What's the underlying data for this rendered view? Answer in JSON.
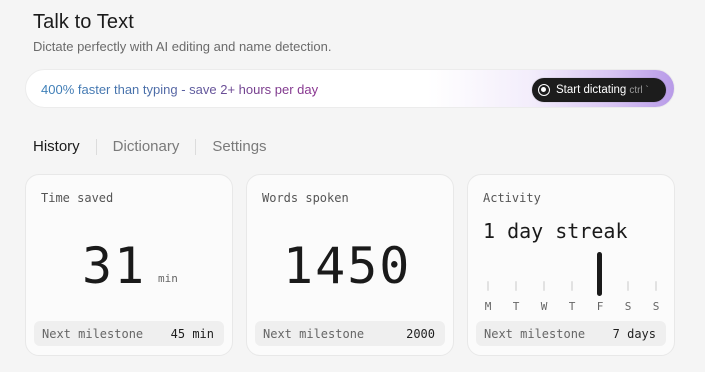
{
  "header": {
    "title": "Talk to Text",
    "subtitle": "Dictate perfectly with AI editing and name detection."
  },
  "banner": {
    "text": "400% faster than typing - save 2+ hours per day",
    "button_label": "Start dictating",
    "button_shortcut": "ctrl `"
  },
  "tabs": [
    {
      "label": "History",
      "active": true
    },
    {
      "label": "Dictionary",
      "active": false
    },
    {
      "label": "Settings",
      "active": false
    }
  ],
  "cards": {
    "time_saved": {
      "label": "Time saved",
      "value": "31",
      "unit": "min",
      "milestone_label": "Next milestone",
      "milestone_value": "45 min"
    },
    "words_spoken": {
      "label": "Words spoken",
      "value": "1450",
      "milestone_label": "Next milestone",
      "milestone_value": "2000"
    },
    "activity": {
      "label": "Activity",
      "streak": "1 day streak",
      "days": [
        {
          "letter": "M",
          "active": false
        },
        {
          "letter": "T",
          "active": false
        },
        {
          "letter": "W",
          "active": false
        },
        {
          "letter": "T",
          "active": false
        },
        {
          "letter": "F",
          "active": true
        },
        {
          "letter": "S",
          "active": false
        },
        {
          "letter": "S",
          "active": false
        }
      ],
      "milestone_label": "Next milestone",
      "milestone_value": "7 days"
    }
  },
  "colors": {
    "accent": "#b89be8",
    "button_bg": "#1c1c1c"
  }
}
